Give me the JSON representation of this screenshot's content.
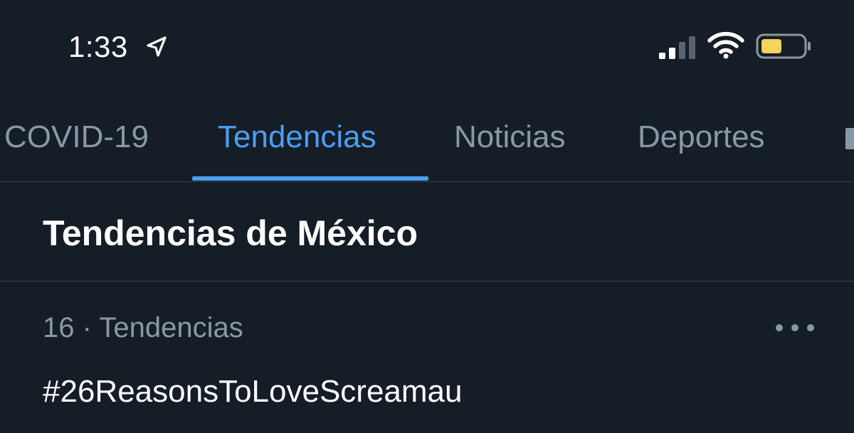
{
  "status_bar": {
    "time": "1:33",
    "icons": [
      "location-arrow-icon",
      "cellular-signal-icon",
      "wifi-icon",
      "battery-icon"
    ],
    "battery_color": "#f3d35a"
  },
  "tabs": [
    {
      "label": "COVID-19",
      "active": false
    },
    {
      "label": "Tendencias",
      "active": true
    },
    {
      "label": "Noticias",
      "active": false
    },
    {
      "label": "Deportes",
      "active": false
    }
  ],
  "section": {
    "title": "Tendencias de México"
  },
  "trend": {
    "rank": "16",
    "separator": "·",
    "category": "Tendencias",
    "name": "#26ReasonsToLoveScreamau",
    "more_icon": "more-horizontal-icon"
  },
  "colors": {
    "background": "#151d27",
    "accent": "#4a9ff0",
    "muted_text": "#8899a6",
    "divider": "#38444d"
  }
}
